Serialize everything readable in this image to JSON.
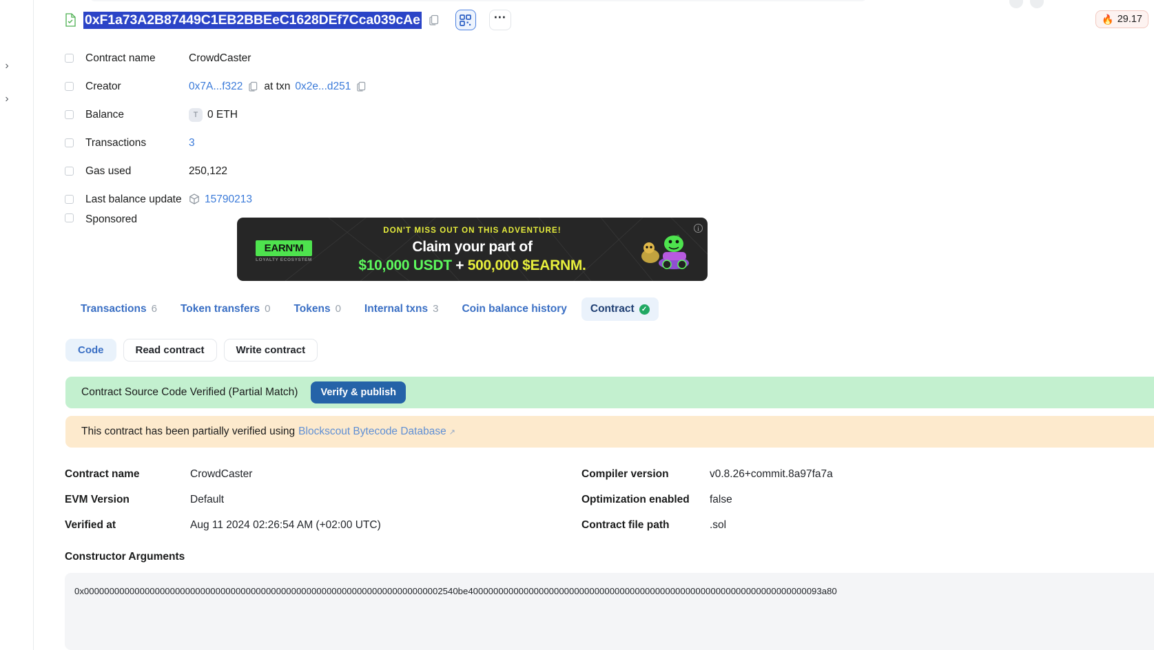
{
  "window": {
    "gas_price": "29.17",
    "gas_icon": "flame-icon"
  },
  "address_header": {
    "address": "0xF1a73A2B87449C1EB2BBEeC1628DEf7Cca039cAe",
    "file_icon": "verified-contract-file-icon",
    "copy_icon": "copy-icon",
    "qr_icon": "qr-code-icon",
    "more_icon": "more-options-icon"
  },
  "details": {
    "rows": [
      {
        "label": "Contract name",
        "value": "CrowdCaster",
        "type": "text"
      },
      {
        "label": "Creator",
        "value": "0x7A...f322",
        "at_label": "at txn",
        "txn": "0x2e...d251",
        "type": "creator"
      },
      {
        "label": "Balance",
        "value": "0 ETH",
        "badge": "T",
        "type": "balance"
      },
      {
        "label": "Transactions",
        "value": "3",
        "type": "link"
      },
      {
        "label": "Gas used",
        "value": "250,122",
        "type": "text"
      },
      {
        "label": "Last balance update",
        "value": "15790213",
        "type": "block"
      },
      {
        "label": "Sponsored",
        "value": "",
        "type": "banner"
      }
    ]
  },
  "banner": {
    "headline": "DON'T MISS OUT ON THIS ADVENTURE!",
    "line1": "Claim your part of",
    "amount1": "$10,000 USDT",
    "plus": "+",
    "amount2": "500,000 $EARNM.",
    "logo": "EARN'M",
    "logo_sub": "LOYALTY ECOSYSTEM",
    "info_icon": "info-icon",
    "accent_yellow": "#e8ef3c",
    "accent_green": "#5dfa5d"
  },
  "tabs": [
    {
      "label": "Transactions",
      "count": "6",
      "active": false
    },
    {
      "label": "Token transfers",
      "count": "0",
      "active": false
    },
    {
      "label": "Tokens",
      "count": "0",
      "active": false
    },
    {
      "label": "Internal txns",
      "count": "3",
      "active": false
    },
    {
      "label": "Coin balance history",
      "count": "",
      "active": false
    },
    {
      "label": "Contract",
      "count": "",
      "active": true,
      "check": true
    }
  ],
  "subtabs": [
    {
      "label": "Code",
      "active": true
    },
    {
      "label": "Read contract",
      "active": false
    },
    {
      "label": "Write contract",
      "active": false
    }
  ],
  "verified_banner": {
    "text": "Contract Source Code Verified (Partial Match)",
    "button": "Verify & publish",
    "bg": "#c3f0cf"
  },
  "partial_banner": {
    "text": "This contract has been partially verified using",
    "link": "Blockscout Bytecode Database",
    "external_icon": "external-link-icon",
    "bg": "#fdeacd"
  },
  "meta": {
    "rows": [
      {
        "l1": "Contract name",
        "v1": "CrowdCaster",
        "l2": "Compiler version",
        "v2": "v0.8.26+commit.8a97fa7a"
      },
      {
        "l1": "EVM Version",
        "v1": "Default",
        "l2": "Optimization enabled",
        "v2": "false"
      },
      {
        "l1": "Verified at",
        "v1": "Aug 11 2024 02:26:54 AM (+02:00 UTC)",
        "l2": "Contract file path",
        "v2": ".sol"
      }
    ]
  },
  "constructor": {
    "title": "Constructor Arguments",
    "hex": "0x00000000000000000000000000000000000000000000000000000000000000000000002540be4000000000000000000000000000000000000000000000000000000000000000000093a80"
  }
}
